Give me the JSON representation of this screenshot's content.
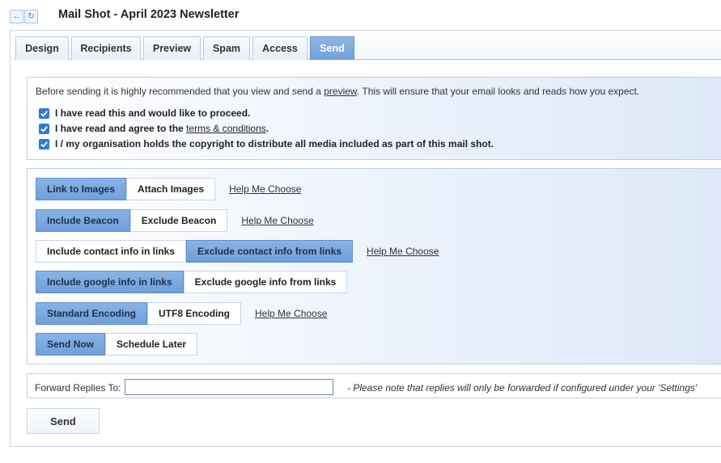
{
  "nav": {
    "back_icon": "←",
    "refresh_icon": "↻"
  },
  "title": "Mail Shot - April 2023 Newsletter",
  "tabs": [
    {
      "label": "Design"
    },
    {
      "label": "Recipients"
    },
    {
      "label": "Preview"
    },
    {
      "label": "Spam"
    },
    {
      "label": "Access"
    },
    {
      "label": "Send"
    }
  ],
  "active_tab": "Send",
  "notice": {
    "before": "Before sending it is highly recommended that you view and send a ",
    "link": "preview",
    "after": ". This will ensure that your email looks and reads how you expect."
  },
  "checks": {
    "proceed": "I have read this and would like to proceed.",
    "terms_before": "I have read and agree to the ",
    "terms_link": "terms & conditions",
    "terms_after": ".",
    "copyright": "I / my organisation holds the copyright to distribute all media included as part of this mail shot."
  },
  "options": {
    "images": {
      "a": "Link to Images",
      "b": "Attach Images",
      "help": "Help Me Choose"
    },
    "beacon": {
      "a": "Include Beacon",
      "b": "Exclude Beacon",
      "help": "Help Me Choose"
    },
    "contact": {
      "a": "Include contact info in links",
      "b": "Exclude contact info from links",
      "help": "Help Me Choose"
    },
    "google": {
      "a": "Include google info in links",
      "b": "Exclude google info from links"
    },
    "encoding": {
      "a": "Standard Encoding",
      "b": "UTF8 Encoding",
      "help": "Help Me Choose"
    },
    "schedule": {
      "a": "Send Now",
      "b": "Schedule Later"
    }
  },
  "forward": {
    "label": "Forward Replies To:",
    "value": "",
    "note": "- Please note that replies will only be forwarded if configured under your 'Settings'"
  },
  "send_label": "Send",
  "colors": {
    "accent": "#6f9fdb",
    "checkbox": "#2f7ad8"
  }
}
